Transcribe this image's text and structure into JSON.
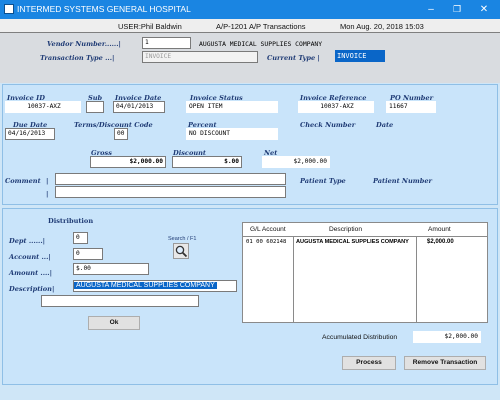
{
  "window": {
    "title": "INTERMED SYSTEMS GENERAL HOSPITAL"
  },
  "status": {
    "user": "USER:Phil Baldwin",
    "screen": "A/P-1201  A/P Transactions",
    "datetime": "Mon Aug. 20, 2018 15:03"
  },
  "vendor": {
    "label": "Vendor Number......|",
    "number": "1",
    "name": "AUGUSTA MEDICAL SUPPLIES COMPANY"
  },
  "transaction": {
    "label": "Transaction Type ...|",
    "value": "INVOICE",
    "current_label": "Current Type |",
    "current_value": "INVOICE"
  },
  "invoice": {
    "id_label": "Invoice ID",
    "id": "10037-AXZ",
    "sub_label": "Sub",
    "sub": "",
    "date_label": "Invoice Date",
    "date": "04/01/2013",
    "status_label": "Invoice Status",
    "status": "OPEN ITEM",
    "ref_label": "Invoice Reference",
    "ref": "10037-AXZ",
    "po_label": "PO Number",
    "po": "11667",
    "due_label": "Due Date",
    "due": "04/16/2013",
    "terms_label": "Terms/Discount Code",
    "terms": "00",
    "percent_label": "Percent",
    "percent": "NO DISCOUNT",
    "check_label": "Check Number",
    "check_date_label": "Date",
    "gross_label": "Gross",
    "gross": "$2,000.00",
    "discount_label": "Discount",
    "discount": "$.00",
    "net_label": "Net",
    "net": "$2,000.00",
    "comment_label": "Comment",
    "comment_sep": "|",
    "patient_type_label": "Patient Type",
    "patient_number_label": "Patient Number"
  },
  "distribution": {
    "title": "Distribution",
    "dept_label": "Dept ......|",
    "dept": "0",
    "account_label": "Account ...|",
    "account": "0",
    "amount_label": "Amount ....|",
    "amount": "$.00",
    "description_label": "Description|",
    "description": "AUGUSTA MEDICAL SUPPLIES COMPANY",
    "search_label": "Search / F1",
    "ok_label": "Ok"
  },
  "grid": {
    "headers": [
      "G/L Account",
      "Description",
      "Amount"
    ],
    "rows": [
      [
        "01 00 602148",
        "AUGUSTA MEDICAL SUPPLIES COMPANY",
        "$2,000.00"
      ]
    ]
  },
  "footer": {
    "accum_label": "Accumulated Distribution",
    "accum_value": "$2,000.00",
    "process_label": "Process",
    "remove_label": "Remove Transaction"
  },
  "colors": {
    "titlebar": "#1a85e2",
    "panel": "#c9e4fa",
    "label": "#1f3b75",
    "selection": "#0a66c8"
  }
}
